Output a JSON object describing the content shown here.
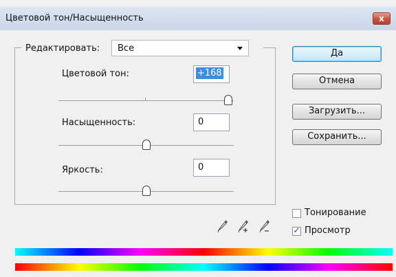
{
  "window": {
    "title": "Цветовой тон/Насыщенность",
    "close_label": "x"
  },
  "edit": {
    "label": "Редактировать:",
    "selected": "Все"
  },
  "hue": {
    "label": "Цветовой тон:",
    "value": "+168",
    "level": 0.967
  },
  "saturation": {
    "label": "Насыщенность:",
    "value": "0",
    "level": 0.5
  },
  "lightness": {
    "label": "Яркость:",
    "value": "0",
    "level": 0.5
  },
  "buttons": {
    "ok": "Да",
    "cancel": "Отмена",
    "load": "Загрузить...",
    "save": "Сохранить..."
  },
  "options": {
    "colorize_label": "Тонирование",
    "colorize_checked": false,
    "preview_label": "Просмотр",
    "preview_checked": true
  },
  "eyedroppers": [
    "eyedropper-icon",
    "eyedropper-add-icon",
    "eyedropper-subtract-icon"
  ],
  "colors": {
    "title_bar": "#c9d6e8",
    "selection": "#3a8ee6",
    "close_button": "#c8533f"
  }
}
